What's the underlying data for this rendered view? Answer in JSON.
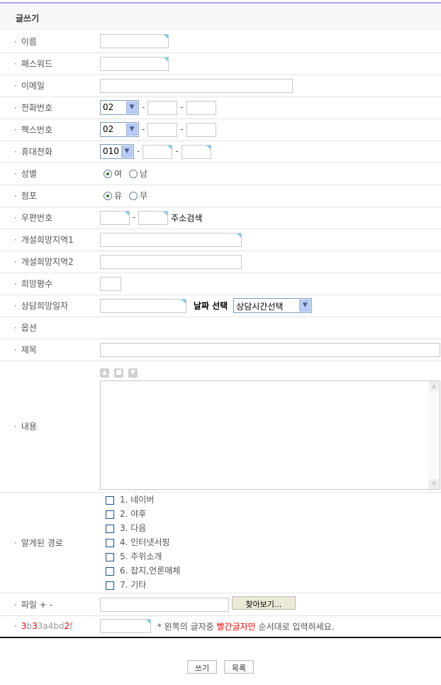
{
  "title": "글쓰기",
  "labels": {
    "name": "이름",
    "password": "패스워드",
    "email": "이메일",
    "phone": "전화번호",
    "fax": "팩스번호",
    "mobile": "휴대전화",
    "gender": "성별",
    "store": "점포",
    "zip": "우편번호",
    "region1": "개설희망지역1",
    "region2": "개설희망지역2",
    "area": "희망평수",
    "date": "상담희망일자",
    "option": "옵션",
    "subject": "제목",
    "content": "내용",
    "source": "알게된 경로",
    "file": "파일 + -"
  },
  "phone": {
    "area": "02"
  },
  "fax": {
    "area": "02"
  },
  "mobile": {
    "prefix": "010"
  },
  "gender": {
    "options": [
      "여",
      "남"
    ],
    "selected": "여"
  },
  "store": {
    "options": [
      "유",
      "무"
    ],
    "selected": "유"
  },
  "zip": {
    "search": "주소검색"
  },
  "date": {
    "pick": "날짜 선택",
    "time_select": "상담시간선택"
  },
  "sources": [
    "1. 네이버",
    "2. 야후",
    "3. 다음",
    "4. 인터넷서핑",
    "5. 주위소개",
    "6. 잡지,언론매체",
    "7. 기타"
  ],
  "file": {
    "browse": "찾아보기..."
  },
  "captcha": {
    "chars": [
      "3",
      "b",
      "3",
      "3a4bd",
      "2",
      "f"
    ],
    "hint_pre": "* 왼쪽의 글자중 ",
    "hint_red": "빨간글자만",
    "hint_post": " 순서대로 입력하세요."
  },
  "buttons": {
    "write": "쓰기",
    "list": "목록"
  }
}
